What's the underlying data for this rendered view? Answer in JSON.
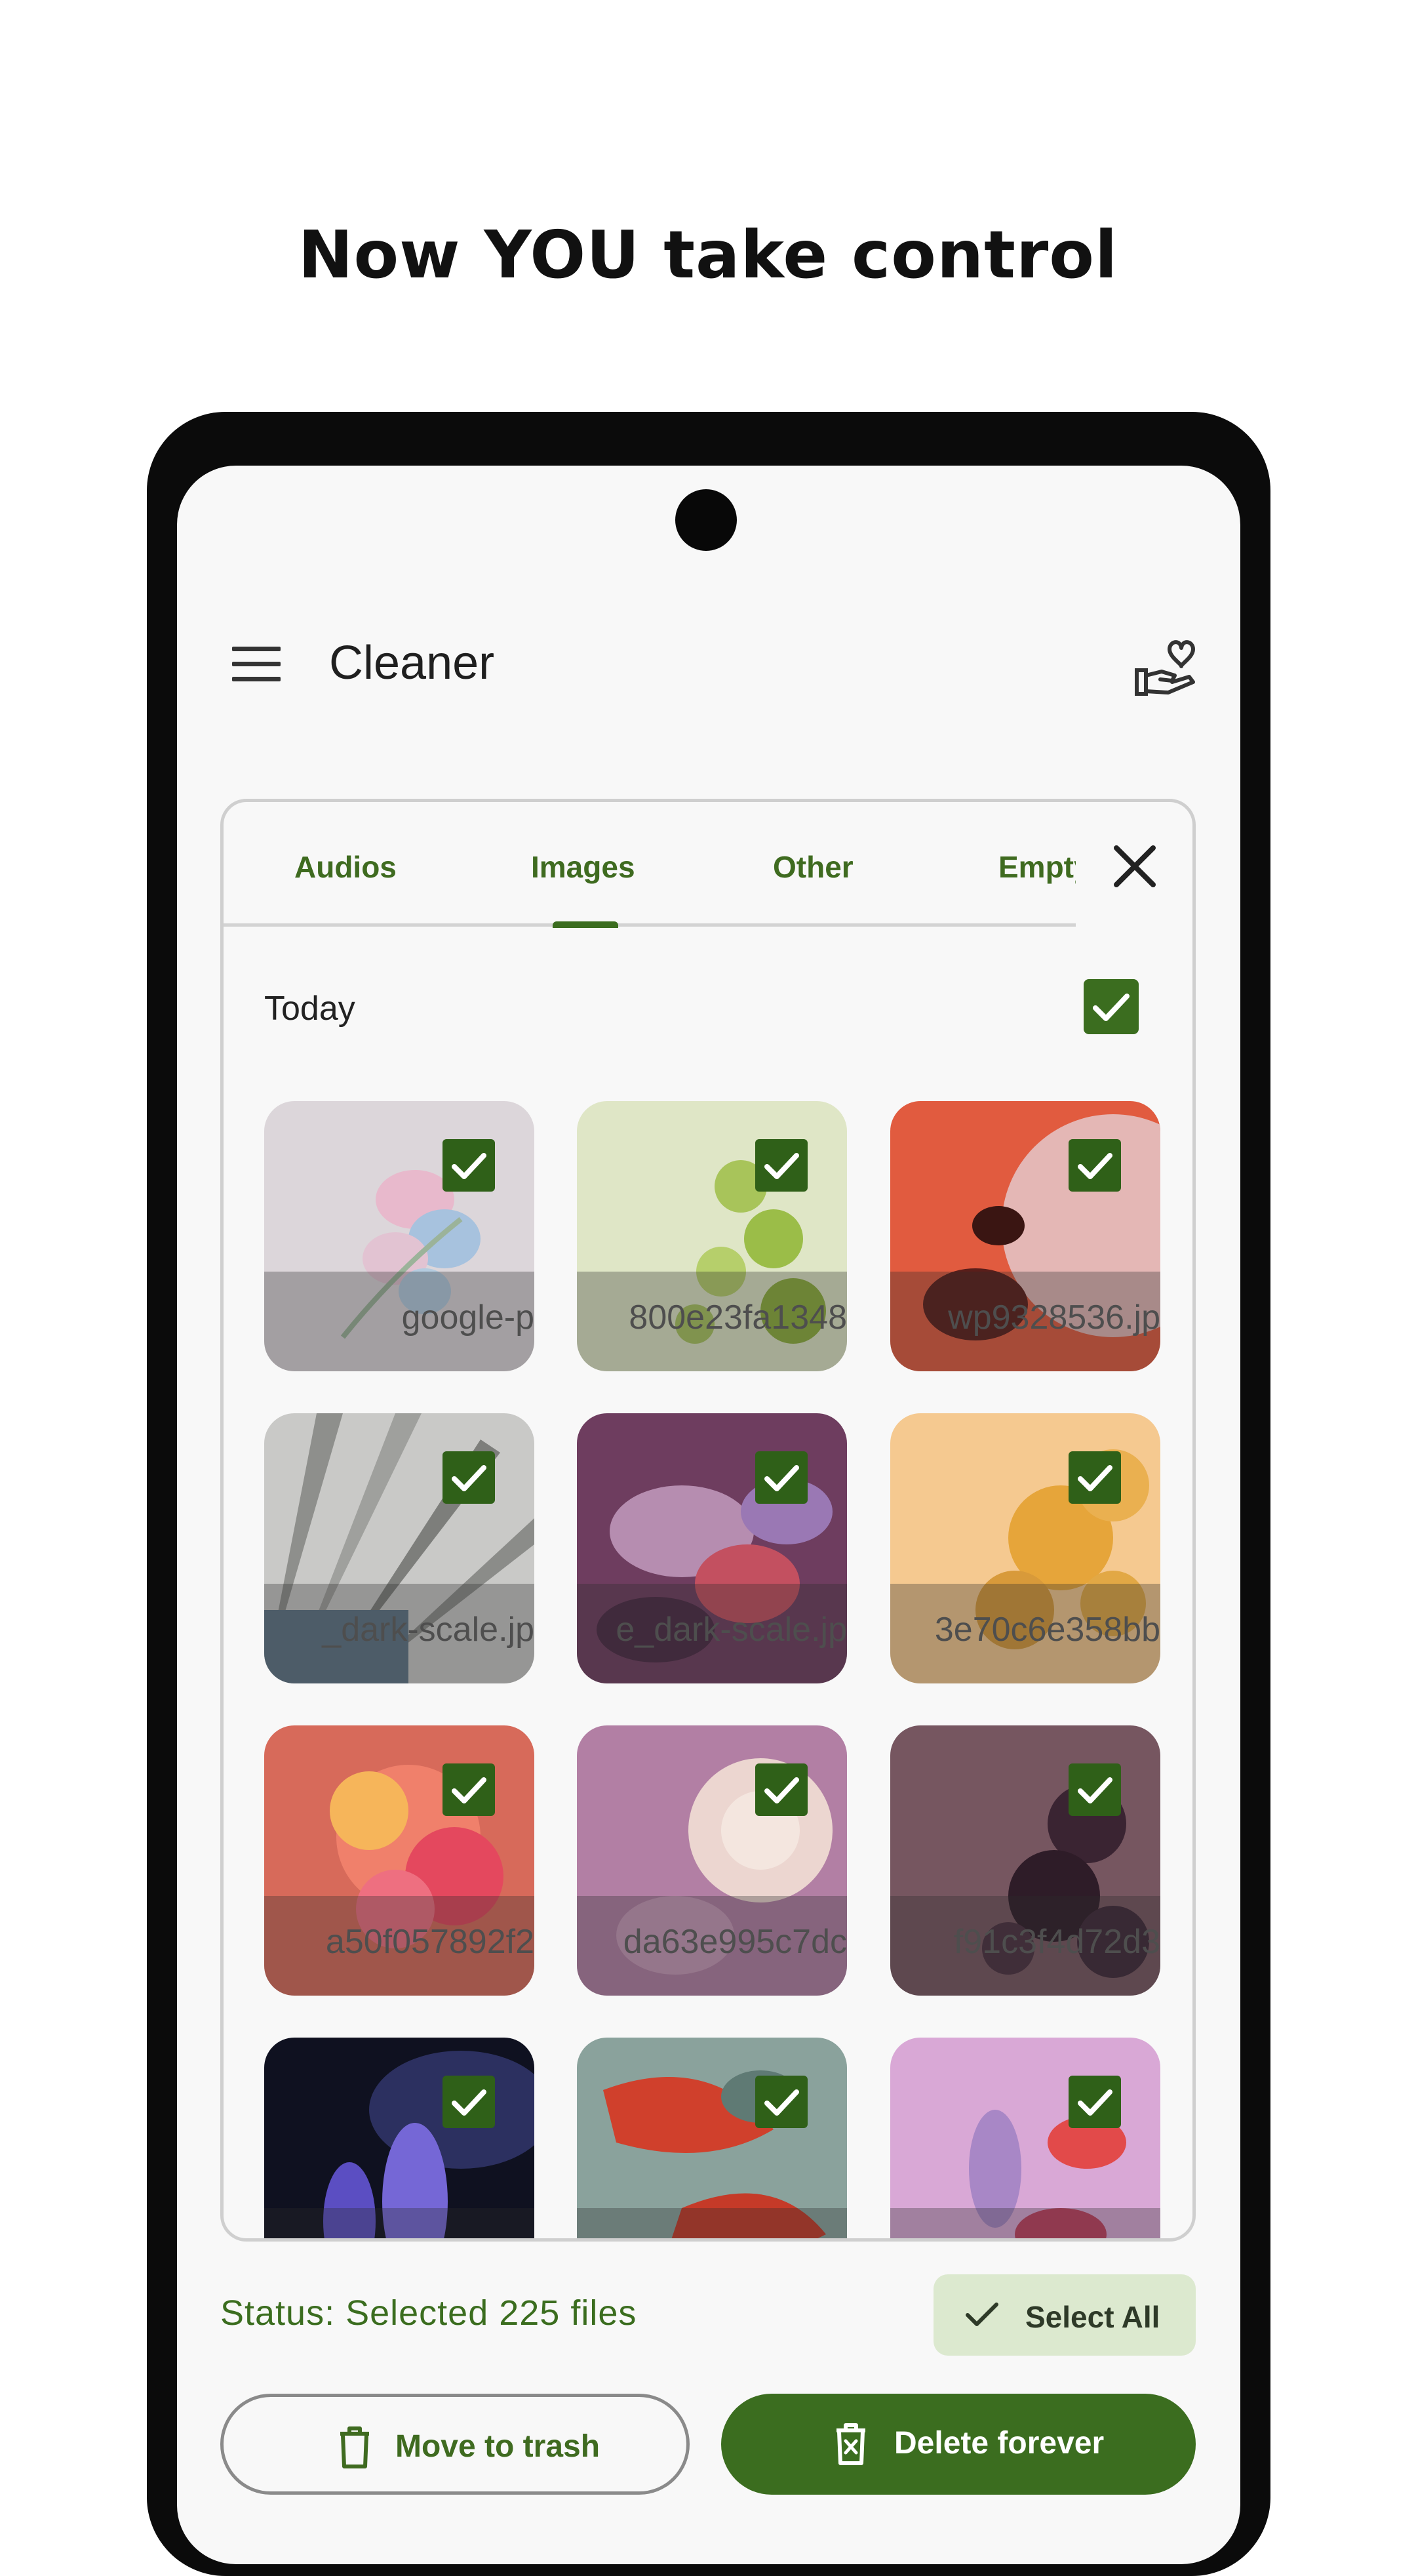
{
  "headline": "Now YOU take control",
  "appbar": {
    "title": "Cleaner",
    "menu_icon": "hamburger-menu-icon",
    "action_icon": "hand-heart-icon"
  },
  "tabs": [
    {
      "label": "Audios",
      "selected": false
    },
    {
      "label": "Images",
      "selected": true
    },
    {
      "label": "Other",
      "selected": false
    },
    {
      "label": "Empty",
      "selected": false
    }
  ],
  "close_icon": "close-icon",
  "section": {
    "label": "Today",
    "checked": true
  },
  "tiles": [
    {
      "name": "google-p",
      "checked": true
    },
    {
      "name": "800e23fa1348",
      "checked": true
    },
    {
      "name": "wp9328536.jp",
      "checked": true
    },
    {
      "name": "_dark-scale.jp",
      "checked": true
    },
    {
      "name": "e_dark-scale.jp",
      "checked": true
    },
    {
      "name": "3e70c6e358bb",
      "checked": true
    },
    {
      "name": "a50f057892f2",
      "checked": true
    },
    {
      "name": "da63e995c7dc",
      "checked": true
    },
    {
      "name": "f91c3f4d72d3",
      "checked": true
    },
    {
      "name": "",
      "checked": true
    },
    {
      "name": "",
      "checked": true
    },
    {
      "name": "",
      "checked": true
    }
  ],
  "status": "Status: Selected 225 files",
  "select_all_label": "Select All",
  "move_to_trash_label": "Move to trash",
  "delete_forever_label": "Delete forever",
  "colors": {
    "accent": "#3b6d1f",
    "accent_light": "#dce9cf",
    "background": "#f8f8f8"
  }
}
